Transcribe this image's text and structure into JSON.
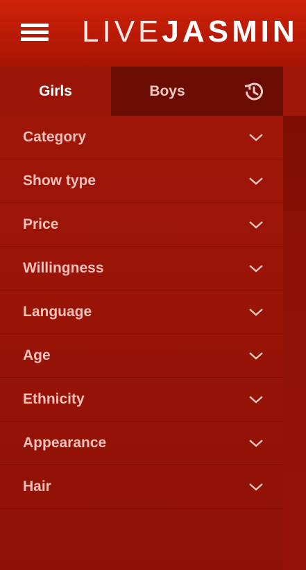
{
  "header": {
    "logo_part1": "LIVE",
    "logo_part2": "JASMIN"
  },
  "tabs": [
    {
      "label": "Girls",
      "active": true
    },
    {
      "label": "Boys",
      "active": false
    }
  ],
  "icons": {
    "menu": "hamburger-menu-icon",
    "history": "history-icon",
    "expand": "chevron-down-icon"
  },
  "filters": [
    {
      "label": "Category"
    },
    {
      "label": "Show type"
    },
    {
      "label": "Price"
    },
    {
      "label": "Willingness"
    },
    {
      "label": "Language"
    },
    {
      "label": "Age"
    },
    {
      "label": "Ethnicity"
    },
    {
      "label": "Appearance"
    },
    {
      "label": "Hair"
    }
  ],
  "colors": {
    "header": "#c51e07",
    "sidebar": "#9a1507",
    "tab_inactive": "#6c0d03",
    "label": "#f4c1bb"
  }
}
